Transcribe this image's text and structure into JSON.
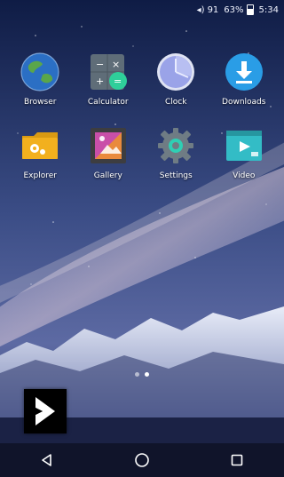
{
  "status_bar": {
    "signal_label": "91",
    "battery_label": "63%",
    "time": "5:34"
  },
  "apps": [
    {
      "label": "Browser",
      "icon": "globe-icon"
    },
    {
      "label": "Calculator",
      "icon": "calculator-icon"
    },
    {
      "label": "Clock",
      "icon": "clock-icon"
    },
    {
      "label": "Downloads",
      "icon": "download-icon"
    },
    {
      "label": "Explorer",
      "icon": "folder-icon"
    },
    {
      "label": "Gallery",
      "icon": "gallery-icon"
    },
    {
      "label": "Settings",
      "icon": "gear-icon"
    },
    {
      "label": "Video",
      "icon": "video-icon"
    }
  ],
  "pagination": {
    "pages": 2,
    "current": 2
  },
  "navigation": [
    "back-button",
    "home-button",
    "recents-button"
  ],
  "colors": {
    "downloads_blue": "#2a9de6",
    "calculator_green": "#2fcf9a",
    "explorer_yellow": "#f2b01e",
    "video_teal": "#33bcc6",
    "clock_face": "#9aa3e8"
  }
}
